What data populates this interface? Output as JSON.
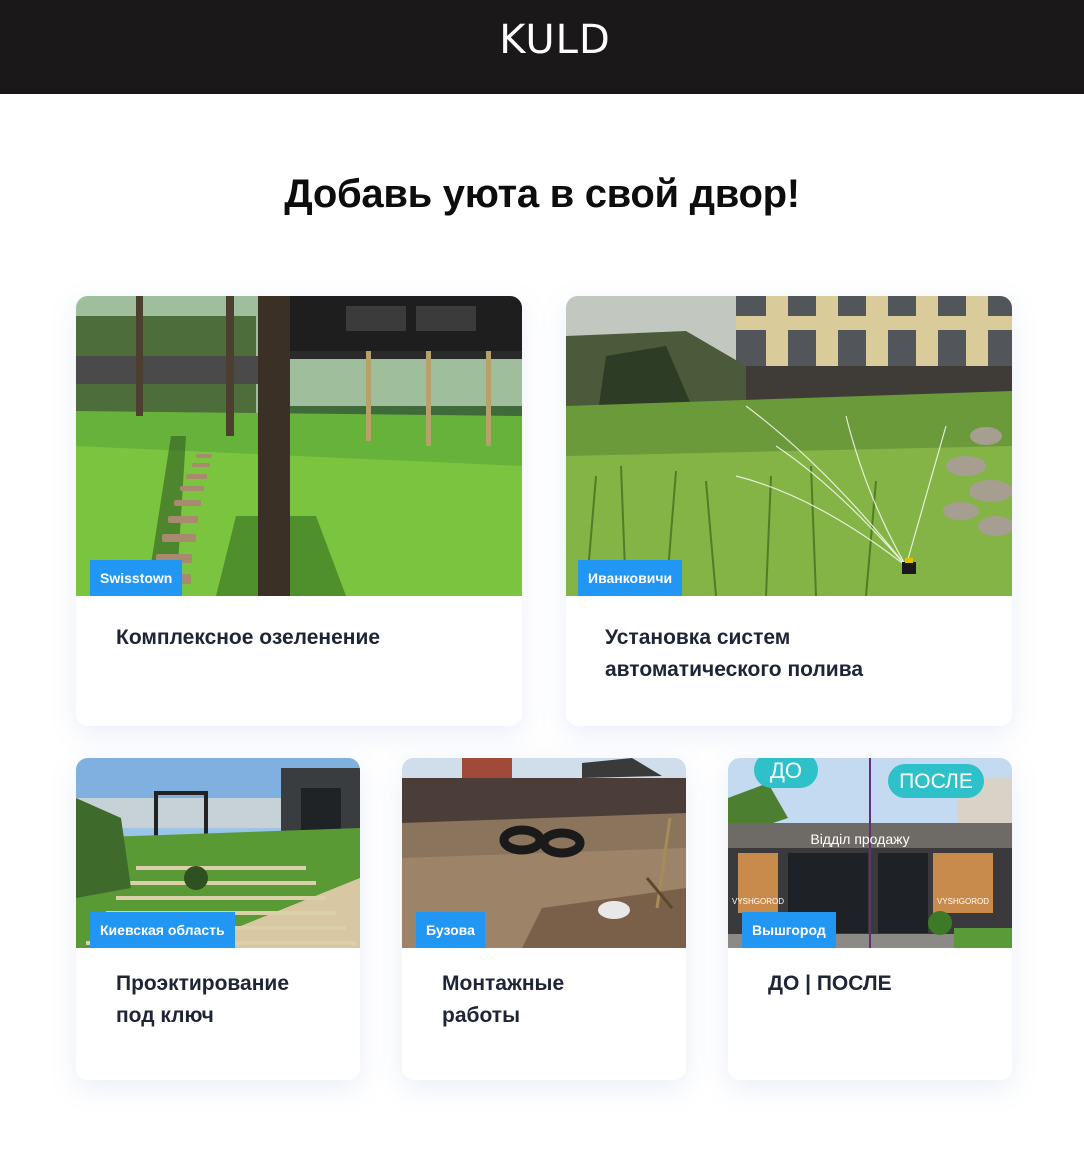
{
  "header": {
    "logo": "KULD"
  },
  "main": {
    "title": "Добавь уюта в свой двор!"
  },
  "cards": [
    {
      "tag": "Swisstown",
      "title": "Комплексное озеленение"
    },
    {
      "tag": "Иванковичи",
      "title_line1": "Установка систем",
      "title_line2": "автоматического полива"
    },
    {
      "tag": "Киевская область",
      "title_line1": "Проэктирование",
      "title_line2": "под ключ"
    },
    {
      "tag": "Бузова",
      "title_line1": "Монтажные",
      "title_line2": "работы"
    },
    {
      "tag": "Вышгород",
      "title": "ДО | ПОСЛЕ",
      "before_badge": "ДО",
      "after_badge": "ПОСЛЕ",
      "sign": "Відділ продажу",
      "brand": "VYSHGOROD"
    }
  ]
}
